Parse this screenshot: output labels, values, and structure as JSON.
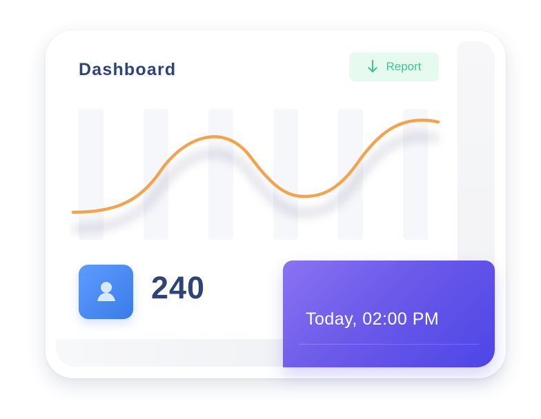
{
  "dashboard": {
    "title": "Dashboard",
    "report_label": "Report",
    "stat_value": "240",
    "time_label": "Today, 02:00 PM"
  },
  "icons": {
    "report": "arrow-down-icon",
    "stat": "user-icon"
  },
  "colors": {
    "title": "#2e4378",
    "report_background": "#e7faf0",
    "report_text": "#41c49c",
    "line": "#f3a34f",
    "stat_icon_start": "#5d9cff",
    "stat_icon_end": "#3b7be8",
    "time_card_start": "#8a72f2",
    "time_card_end": "#4d45e7"
  }
}
